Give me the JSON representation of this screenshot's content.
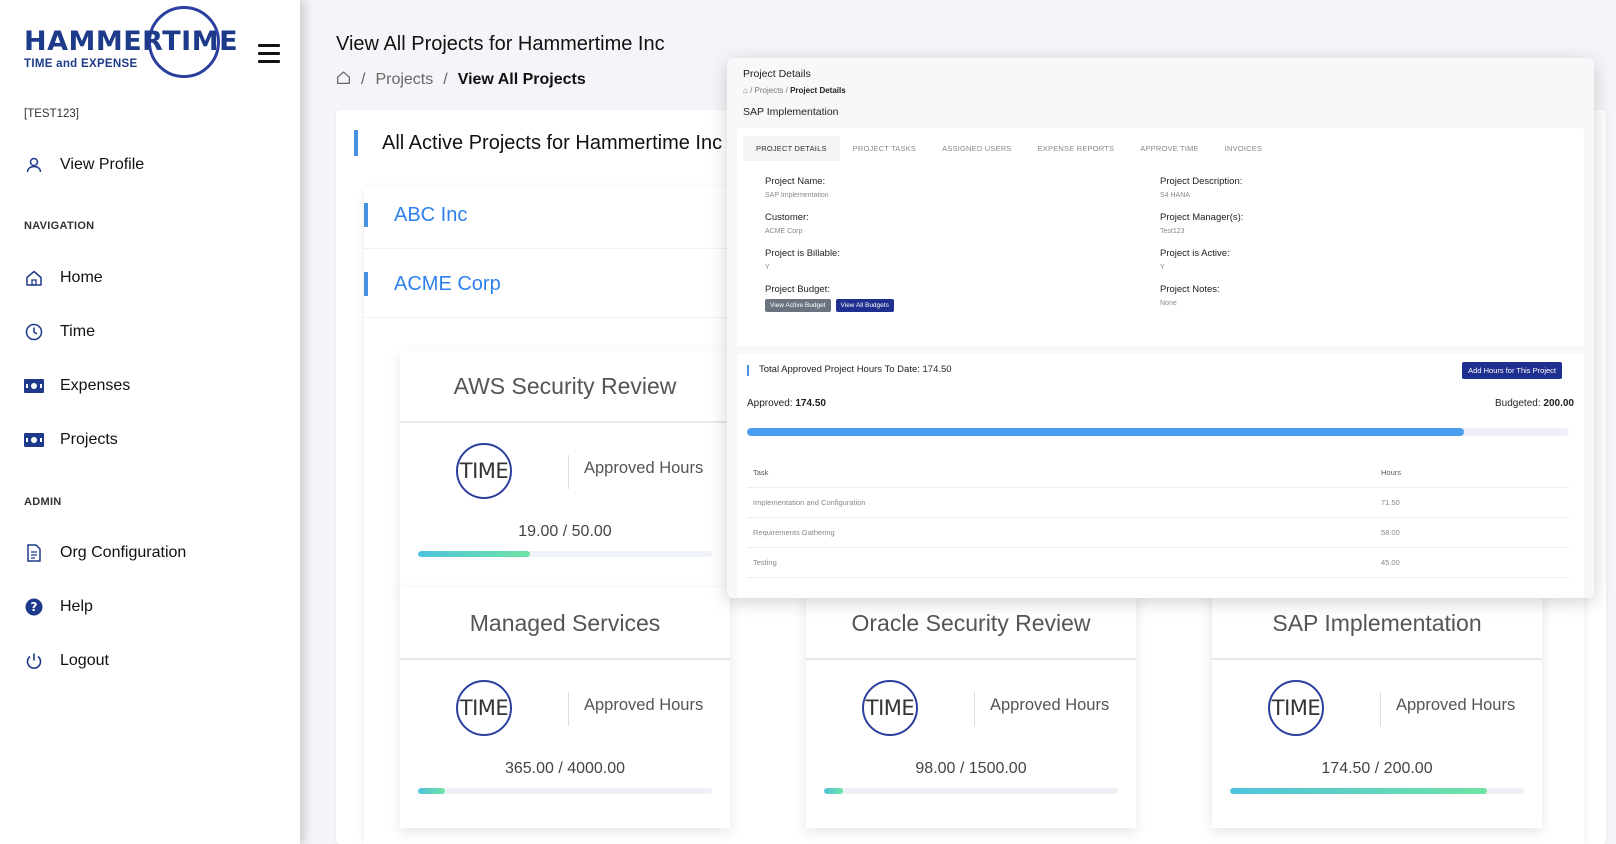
{
  "sidebar": {
    "logo": {
      "word": "HAMMERTIME",
      "sub": "TIME and EXPENSE"
    },
    "user_tag": "[TEST123]",
    "profile": {
      "label": "View Profile",
      "icon": "user-icon"
    },
    "navigation_label": "NAVIGATION",
    "nav_items": [
      {
        "label": "Home",
        "icon": "home-icon"
      },
      {
        "label": "Time",
        "icon": "clock-icon"
      },
      {
        "label": "Expenses",
        "icon": "money-icon"
      },
      {
        "label": "Projects",
        "icon": "money-icon"
      }
    ],
    "admin_label": "ADMIN",
    "admin_items": [
      {
        "label": "Org Configuration",
        "icon": "document-icon"
      },
      {
        "label": "Help",
        "icon": "help-icon"
      },
      {
        "label": "Logout",
        "icon": "power-icon"
      }
    ]
  },
  "header": {
    "title": "View All Projects for Hammertime Inc",
    "breadcrumb": {
      "parent": "Projects",
      "current": "View All Projects",
      "sep": "/"
    }
  },
  "main": {
    "card_title": "All Active Projects for Hammertime Inc",
    "customers": [
      "ABC Inc",
      "ACME Corp"
    ],
    "projects": [
      {
        "name": "AWS Security Review",
        "hours_label": "Approved Hours",
        "hours": "19.00 / 50.00",
        "approved": 19.0,
        "budget": 50.0
      },
      {
        "name": "Managed Services",
        "hours_label": "Approved Hours",
        "hours": "365.00 / 4000.00",
        "approved": 365.0,
        "budget": 4000.0
      },
      {
        "name": "Oracle Security Review",
        "hours_label": "Approved Hours",
        "hours": "98.00 / 1500.00",
        "approved": 98.0,
        "budget": 1500.0
      },
      {
        "name": "SAP Implementation",
        "hours_label": "Approved Hours",
        "hours": "174.50 / 200.00",
        "approved": 174.5,
        "budget": 200.0
      }
    ],
    "time_logo_text": "TIME"
  },
  "overlay": {
    "title": "Project Details",
    "breadcrumb": {
      "parent": "Projects",
      "current": "Project Details"
    },
    "subtitle": "SAP Implementation",
    "tabs": [
      "PROJECT DETAILS",
      "PROJECT TASKS",
      "ASSIGNED USERS",
      "EXPENSE REPORTS",
      "APPROVE TIME",
      "INVOICES"
    ],
    "fields": {
      "project_name": {
        "label": "Project Name:",
        "value": "SAP Implementation"
      },
      "customer": {
        "label": "Customer:",
        "value": "ACME Corp"
      },
      "billable": {
        "label": "Project is Billable:",
        "value": "Y"
      },
      "budget": {
        "label": "Project Budget:",
        "btn_active": "View Active Budget",
        "btn_all": "View All Budgets"
      },
      "description": {
        "label": "Project Description:",
        "value": "S4 HANA"
      },
      "managers": {
        "label": "Project Manager(s):",
        "value": "Test123"
      },
      "active": {
        "label": "Project is Active:",
        "value": "Y"
      },
      "notes": {
        "label": "Project Notes:",
        "value": "None"
      }
    },
    "hours": {
      "title": "Total Approved Project Hours To Date: 174.50",
      "add_button": "Add Hours for This Project",
      "approved_label": "Approved:",
      "approved_value": "174.50",
      "budgeted_label": "Budgeted:",
      "budgeted_value": "200.00",
      "approved_ratio": 0.8725,
      "table_headers": [
        "Task",
        "Hours"
      ],
      "rows": [
        {
          "task": "Implementation and Configuration",
          "hours": "71.50"
        },
        {
          "task": "Requirements Gathering",
          "hours": "58.00"
        },
        {
          "task": "Testing",
          "hours": "45.00"
        }
      ]
    }
  }
}
